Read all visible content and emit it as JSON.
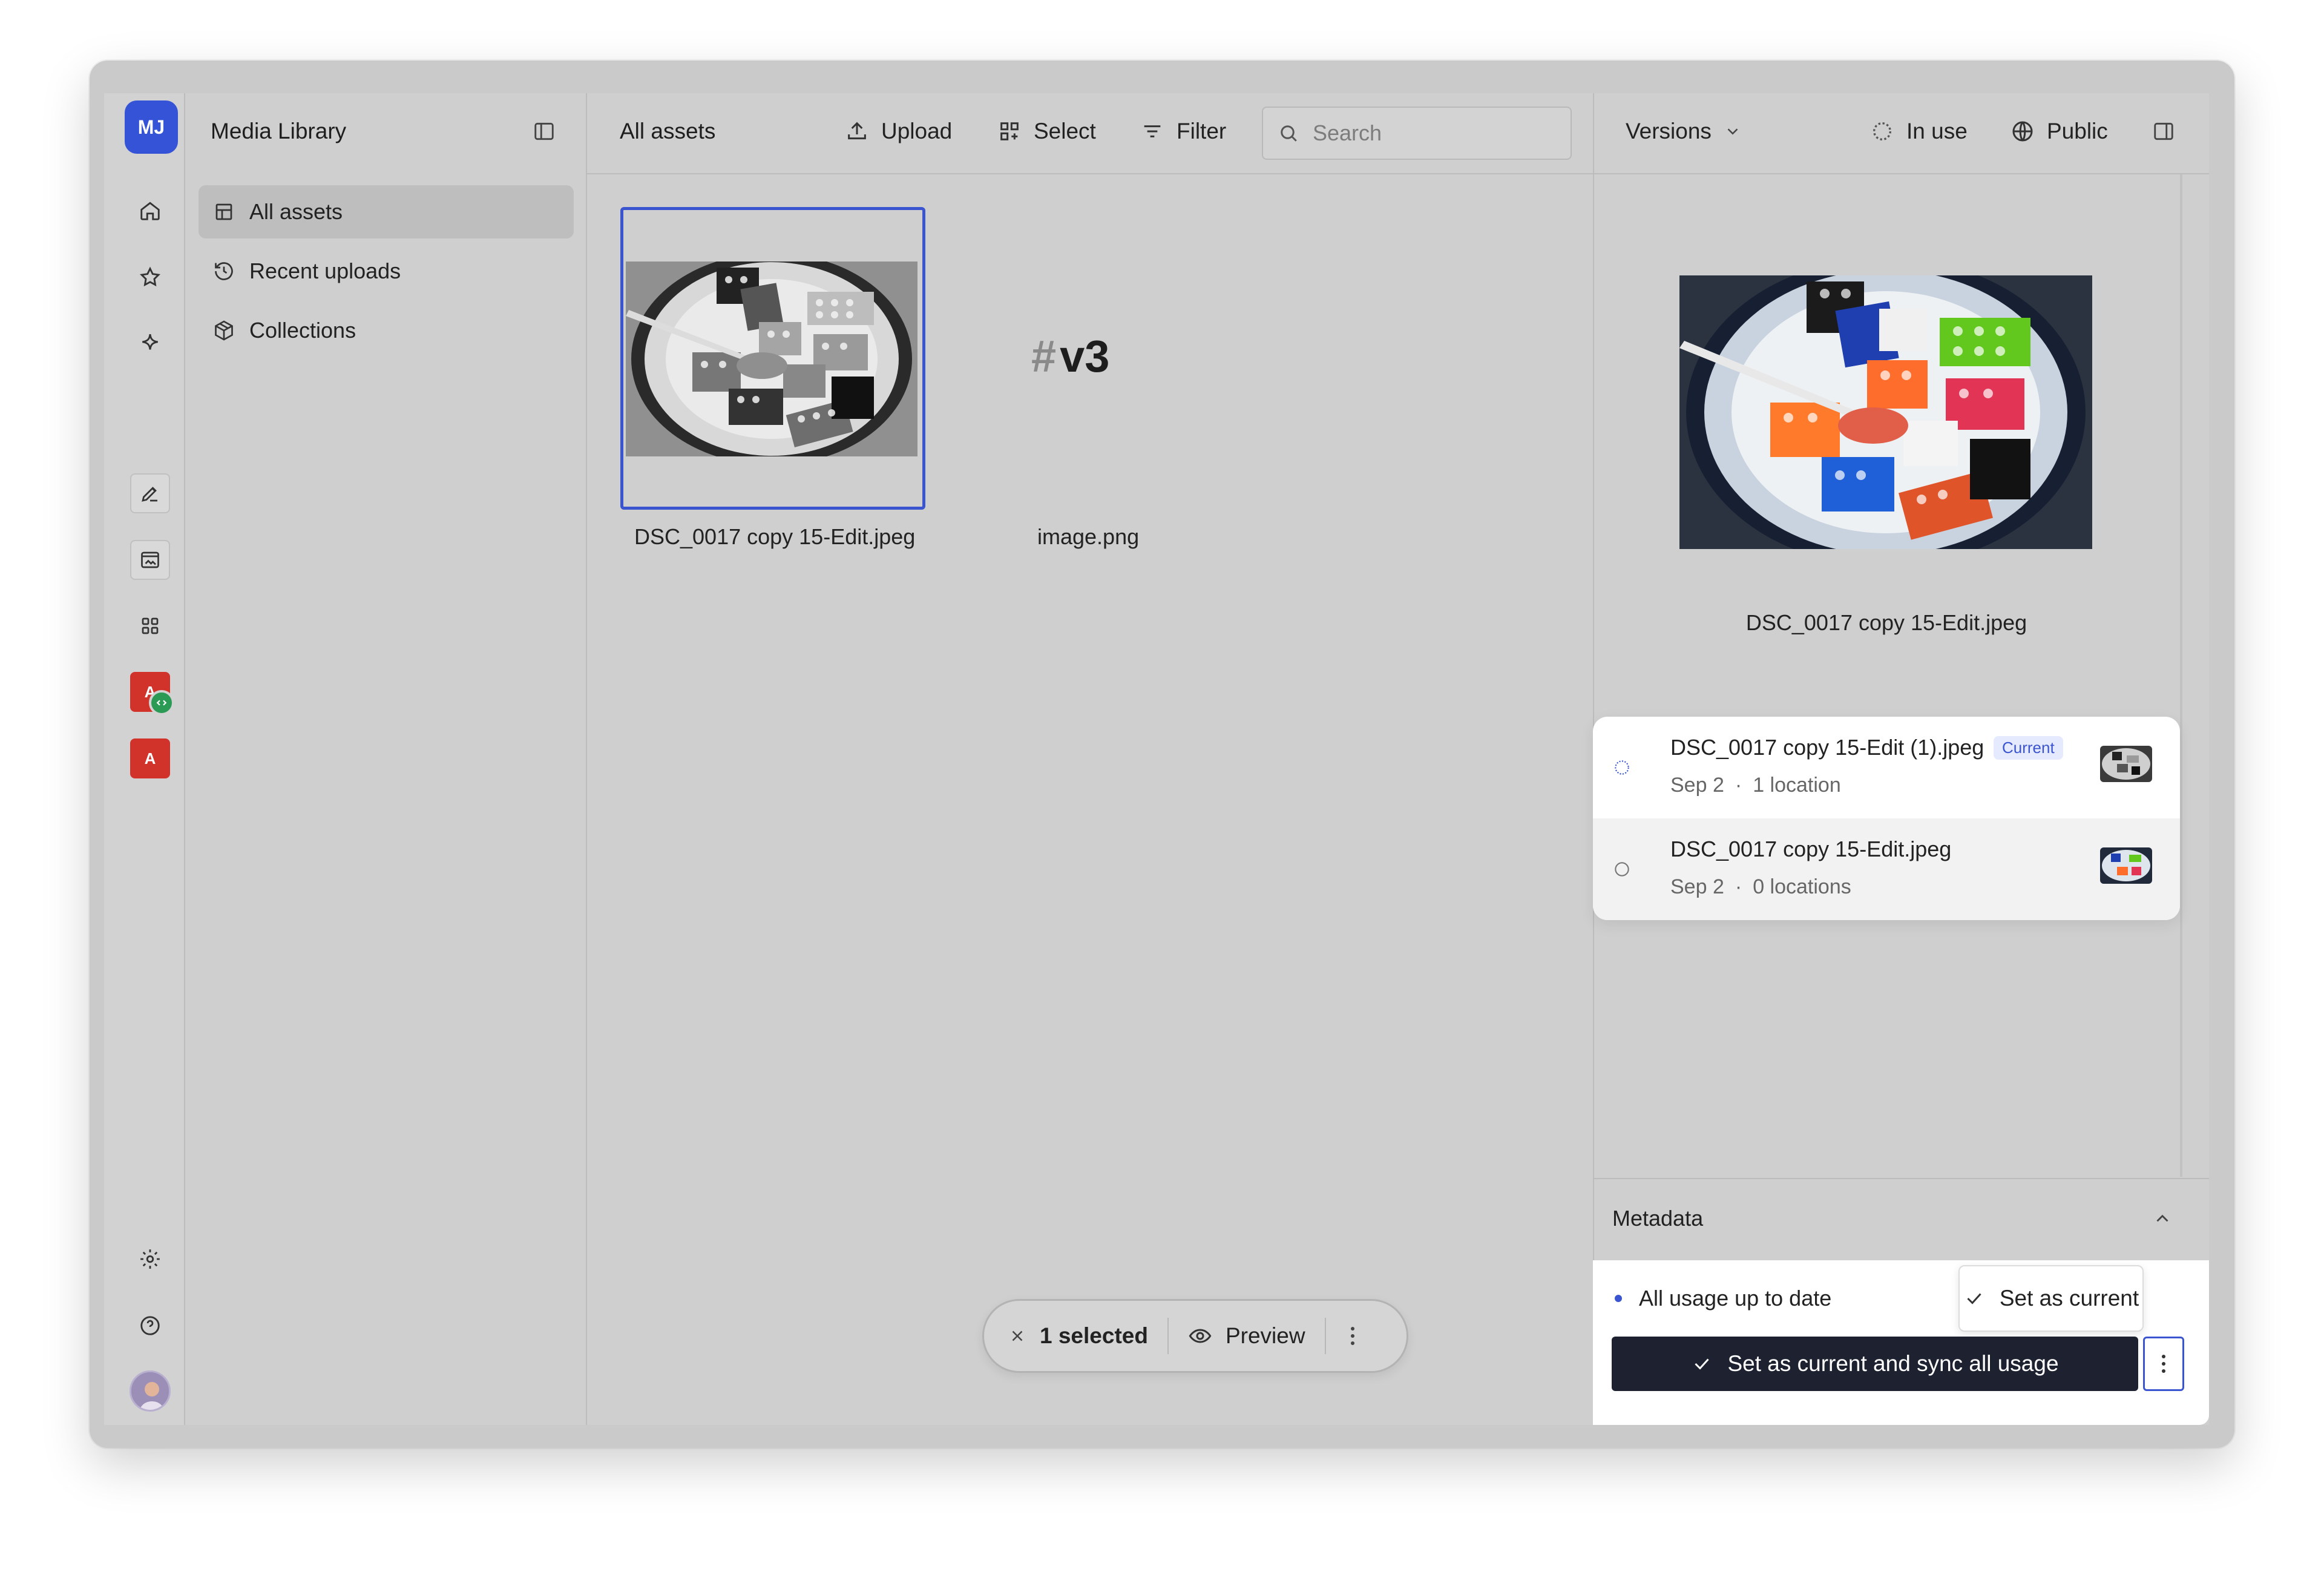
{
  "rail": {
    "avatar_initials": "MJ",
    "items": [
      "home-icon",
      "star-icon",
      "sparkle-icon"
    ],
    "tools": [
      "pen-icon",
      "image-window-icon",
      "grid-icon"
    ],
    "app_a_label": "A",
    "app_b_label": "A",
    "bottom": [
      "settings-icon",
      "help-icon",
      "user-avatar"
    ]
  },
  "sidebar": {
    "title": "Media Library",
    "items": [
      {
        "label": "All assets",
        "icon": "grid-icon",
        "active": true
      },
      {
        "label": "Recent uploads",
        "icon": "history-icon",
        "active": false
      },
      {
        "label": "Collections",
        "icon": "box-icon",
        "active": false
      }
    ]
  },
  "toolbar": {
    "title": "All assets",
    "upload": "Upload",
    "select": "Select",
    "filter": "Filter",
    "search_placeholder": "Search"
  },
  "assets": [
    {
      "name": "DSC_0017 copy 15-Edit.jpeg",
      "selected": true
    },
    {
      "name": "image.png",
      "text_hash": "#",
      "text_version": "v3",
      "selected": false
    }
  ],
  "selection_bar": {
    "count": "1 selected",
    "preview": "Preview"
  },
  "right_panel": {
    "versions": "Versions",
    "in_use": "In use",
    "public": "Public",
    "preview_name": "DSC_0017 copy 15-Edit.jpeg",
    "version_list": [
      {
        "name": "DSC_0017 copy 15-Edit (1).jpeg",
        "badge": "Current",
        "date": "Sep 2",
        "locations": "1 location"
      },
      {
        "name": "DSC_0017 copy 15-Edit.jpeg",
        "badge": "",
        "date": "Sep 2",
        "locations": "0 locations"
      }
    ],
    "metadata": "Metadata",
    "usage_status": "All usage up to date",
    "set_current": "Set as current",
    "set_current_sync": "Set as current and sync all usage"
  },
  "colors": {
    "accent": "#3a55cf",
    "dark_button": "#1e2230",
    "avatar_bg": "#3453d6",
    "app_red": "#d1322a",
    "badge_green": "#2b9a54"
  }
}
